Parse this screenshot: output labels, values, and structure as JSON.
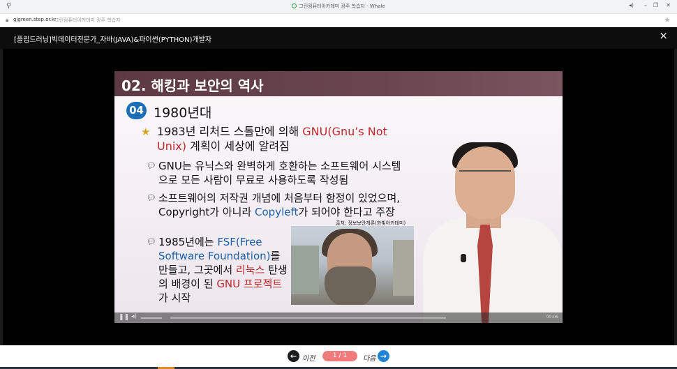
{
  "browser": {
    "window_title": "그린컴퓨터아카데미 광주 학습자 - Whale",
    "domain": "gjgreen.step.or.kr",
    "page_title": "그린컴퓨터아카데미 광주 학습자"
  },
  "lecture": {
    "course_title": "[플립드러닝]빅데이터전문가_자바(JAVA)&파이썬(PYTHON)개발자",
    "close_icon": "×"
  },
  "slide": {
    "title": "02. 해킹과 보안의 역사",
    "section_number": "04",
    "section_title": "1980년대",
    "bullet_main": {
      "part1": "1983년 리처드 스톨만에 의해 ",
      "red1": "GNU(Gnu’s Not Unix)",
      "part2": " 계획이 세상에 알려짐"
    },
    "sub1": "GNU는 유닉스와 완벽하게 호환하는 소프트웨어 시스템으로 모든 사람이 무료로 사용하도록 작성됨",
    "sub2": {
      "part1": "소프트웨어의 저작권 개념에 처음부터 함정이 있었으며, Copyright가 아니라 ",
      "blue1": "Copyleft",
      "part2": "가 되어야 한다고 주장"
    },
    "sub3": {
      "part1": "1985년에는 ",
      "blue1": "FSF(Free Software Foundation)",
      "part2": "를 만들고, 그곳에서 ",
      "red1": "리눅스",
      "part3": " 탄생의 배경이 된 ",
      "red2": "GNU 프로젝트",
      "part4": "가 시작"
    },
    "credit": "출처: 정보보안개론(한빛아카데미)",
    "time": "00:06"
  },
  "pager": {
    "prev_label": "이전",
    "page_indicator": "1 / 1",
    "next_label": "다음"
  },
  "colors": {
    "accent_red": "#c0272d",
    "accent_blue": "#1b5fa8",
    "pager_pill": "#f07b7b",
    "next_button": "#1f84d6"
  }
}
